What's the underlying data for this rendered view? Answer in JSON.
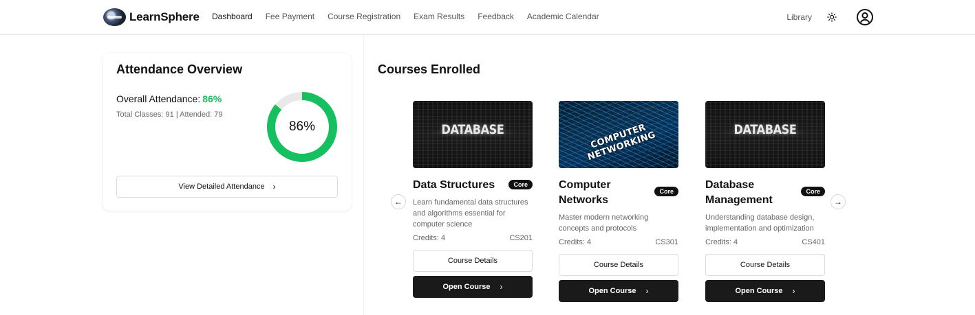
{
  "app": {
    "name": "LearnSphere",
    "logo_icon": "globe-logo"
  },
  "nav": {
    "items": [
      "Dashboard",
      "Fee Payment",
      "Course Registration",
      "Exam Results",
      "Feedback",
      "Academic Calendar"
    ],
    "active": "Dashboard",
    "library_label": "Library",
    "theme_icon": "sun-icon",
    "profile_icon": "user-circle-icon"
  },
  "attendance": {
    "title": "Attendance Overview",
    "overall_label": "Overall Attendance:",
    "overall_value": "86%",
    "overall_percent": 86,
    "summary": "Total Classes: 91 | Attended: 79",
    "ring_label": "86%",
    "button_label": "View Detailed Attendance",
    "button_icon": "chevron-right-icon",
    "accent_color": "#16c060"
  },
  "courses": {
    "title": "Courses Enrolled",
    "prev_icon": "arrow-left-icon",
    "next_icon": "arrow-right-icon",
    "details_label": "Course Details",
    "open_label": "Open Course",
    "items": [
      {
        "name": "Data Structures",
        "badge": "Core",
        "description": "Learn fundamental data structures and algorithms essential for computer science",
        "credits": "Credits: 4",
        "code": "CS201",
        "thumbnail_text": "DATABASE"
      },
      {
        "name": "Computer Networks",
        "badge": "Core",
        "description": "Master modern networking concepts and protocols",
        "credits": "Credits: 4",
        "code": "CS301",
        "thumbnail_text": "COMPUTER NETWORKING"
      },
      {
        "name": "Database Management",
        "badge": "Core",
        "description": "Understanding database design, implementation and optimization",
        "credits": "Credits: 4",
        "code": "CS401",
        "thumbnail_text": "DATABASE"
      }
    ]
  }
}
